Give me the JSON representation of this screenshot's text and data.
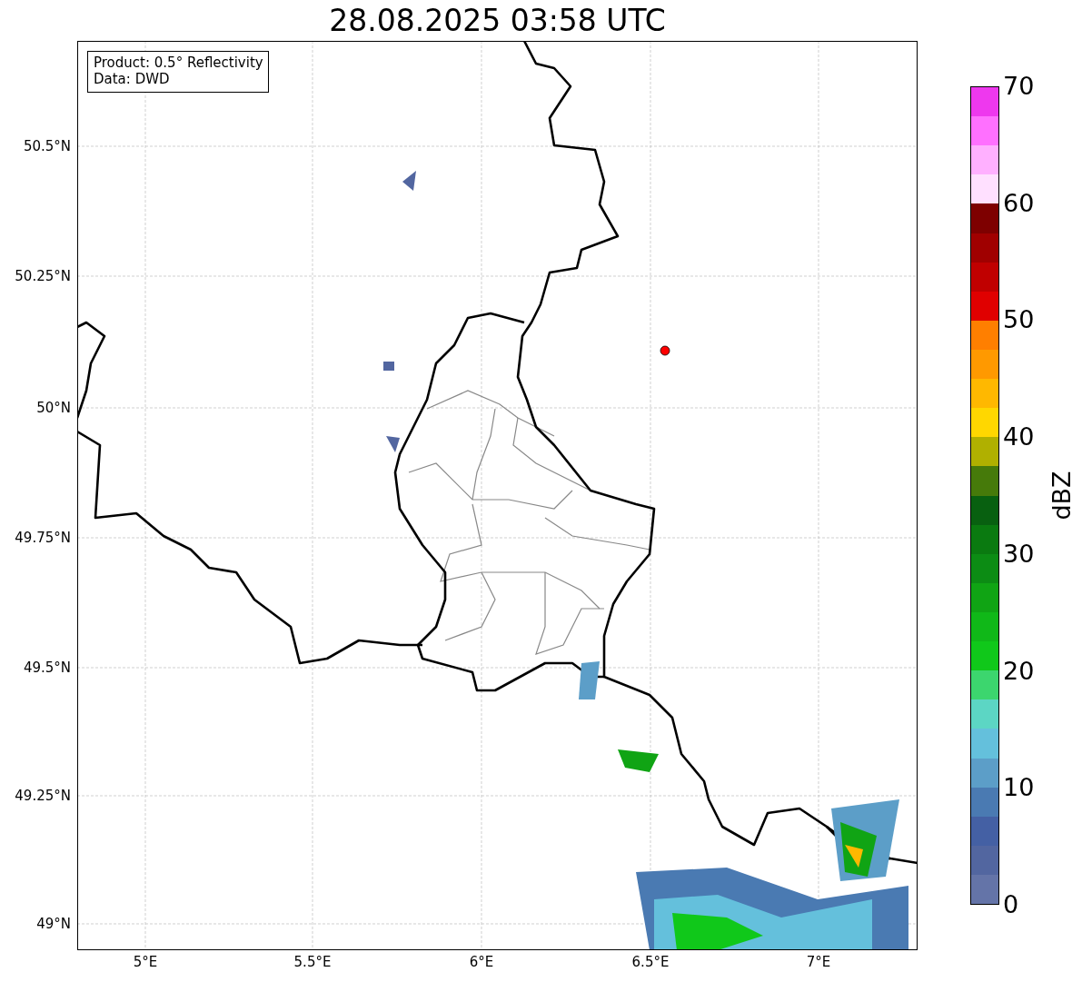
{
  "title": "28.08.2025 03:58 UTC",
  "legend": [
    "Product: 0.5° Reflectivity",
    "Data: DWD"
  ],
  "map": {
    "xticks": [
      "5°E",
      "5.5°E",
      "6°E",
      "6.5°E",
      "7°E"
    ],
    "yticks": [
      "50.5°N",
      "50.25°N",
      "50°N",
      "49.75°N",
      "49.5°N",
      "49.25°N",
      "49°N"
    ]
  },
  "colorbar": {
    "label": "dBZ",
    "ticks": [
      "70",
      "60",
      "50",
      "40",
      "30",
      "20",
      "10",
      "0"
    ],
    "segments": [
      {
        "color": "#6474a8"
      },
      {
        "color": "#5266a0"
      },
      {
        "color": "#4460a4"
      },
      {
        "color": "#4a7ab2"
      },
      {
        "color": "#5c9ec8"
      },
      {
        "color": "#64c0dc"
      },
      {
        "color": "#5cd6c4"
      },
      {
        "color": "#3cd66e"
      },
      {
        "color": "#10c81a"
      },
      {
        "color": "#10b818"
      },
      {
        "color": "#10a414"
      },
      {
        "color": "#0c8c14"
      },
      {
        "color": "#0a7a10"
      },
      {
        "color": "#086010"
      },
      {
        "color": "#467a0a"
      },
      {
        "color": "#b0b000"
      },
      {
        "color": "#ffd700"
      },
      {
        "color": "#ffb800"
      },
      {
        "color": "#ff9900"
      },
      {
        "color": "#ff7f00"
      },
      {
        "color": "#e00000"
      },
      {
        "color": "#c00000"
      },
      {
        "color": "#a00000"
      },
      {
        "color": "#7e0000"
      },
      {
        "color": "#ffe0ff"
      },
      {
        "color": "#ffb0ff"
      },
      {
        "color": "#ff70ff"
      },
      {
        "color": "#ee38ee"
      }
    ]
  }
}
